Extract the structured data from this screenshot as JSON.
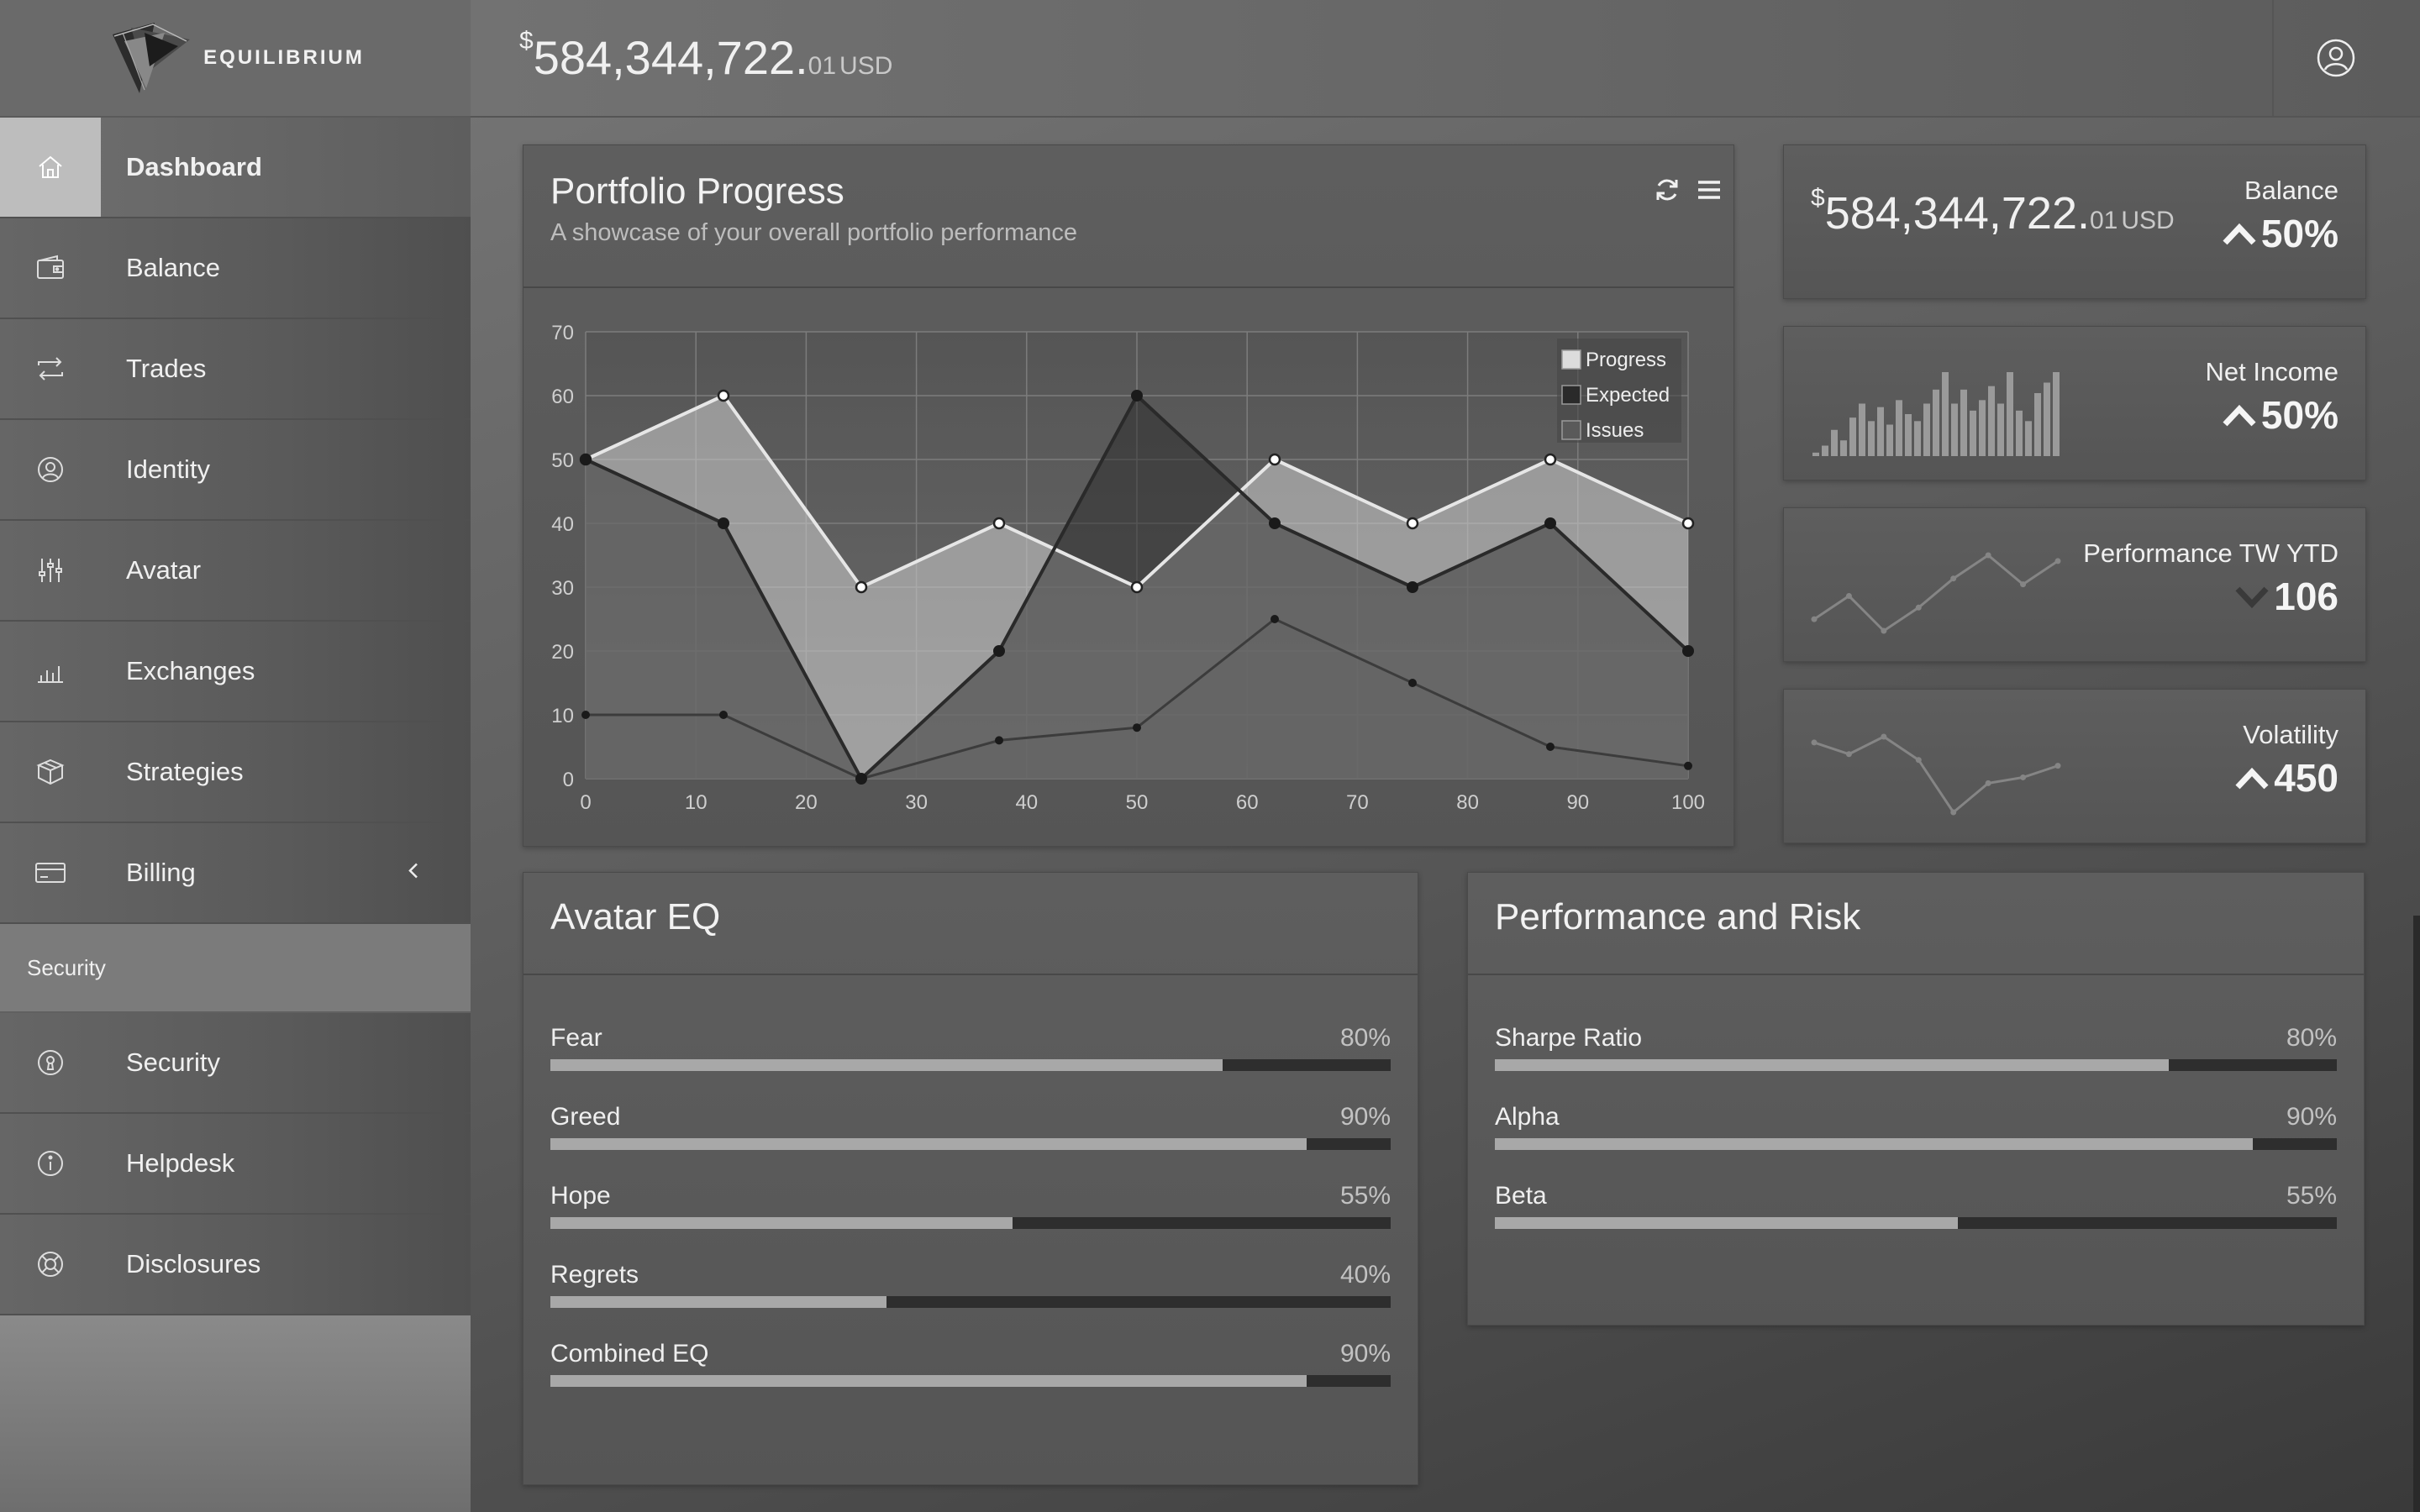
{
  "brand": {
    "name": "EQUILIBRIUM"
  },
  "header": {
    "balance": {
      "currency_symbol": "$",
      "integer": "584,344,722.",
      "cents": "01",
      "unit": "USD"
    },
    "user_icon": "user-icon"
  },
  "sidebar": {
    "items": [
      {
        "label": "Dashboard",
        "icon": "home-icon",
        "active": true
      },
      {
        "label": "Balance",
        "icon": "wallet-icon"
      },
      {
        "label": "Trades",
        "icon": "exchange-arrows-icon"
      },
      {
        "label": "Identity",
        "icon": "user-icon"
      },
      {
        "label": "Avatar",
        "icon": "sliders-icon"
      },
      {
        "label": "Exchanges",
        "icon": "bar-chart-icon"
      },
      {
        "label": "Strategies",
        "icon": "cubes-icon"
      },
      {
        "label": "Billing",
        "icon": "credit-card-icon",
        "chevron": "chevron-left-icon"
      }
    ],
    "section": "Security",
    "section_items": [
      {
        "label": "Security",
        "icon": "keyhole-icon"
      },
      {
        "label": "Helpdesk",
        "icon": "info-icon"
      },
      {
        "label": "Disclosures",
        "icon": "lifebuoy-icon"
      }
    ]
  },
  "portfolio": {
    "title": "Portfolio Progress",
    "subtitle": "A showcase of your overall portfolio performance",
    "refresh_icon": "refresh-icon",
    "menu_icon": "hamburger-menu-icon"
  },
  "chart_data": {
    "type": "area",
    "title": "",
    "xlabel": "",
    "ylabel": "",
    "xlim": [
      0,
      100
    ],
    "ylim": [
      0,
      70
    ],
    "x_ticks": [
      0,
      10,
      20,
      30,
      40,
      50,
      60,
      70,
      80,
      90,
      100
    ],
    "y_ticks": [
      0,
      10,
      20,
      30,
      40,
      50,
      60,
      70
    ],
    "grid": true,
    "legend": "top-right",
    "x": [
      0,
      12.5,
      25,
      37.5,
      50,
      62.5,
      75,
      87.5,
      100
    ],
    "series": [
      {
        "name": "Progress",
        "values": [
          50,
          60,
          30,
          40,
          30,
          50,
          40,
          50,
          40
        ],
        "color": "#d9d9d9"
      },
      {
        "name": "Expected",
        "values": [
          50,
          40,
          0,
          20,
          60,
          40,
          30,
          40,
          20
        ],
        "color": "#2a2a2a"
      },
      {
        "name": "Issues",
        "values": [
          10,
          10,
          0,
          6,
          8,
          25,
          15,
          5,
          2
        ],
        "color": "#4a4a4a"
      }
    ]
  },
  "stats": [
    {
      "label": "Balance",
      "value": "50%",
      "trend": "up",
      "money": {
        "currency_symbol": "$",
        "integer": "584,344,722.",
        "cents": "01",
        "unit": "USD"
      }
    },
    {
      "label": "Net Income",
      "value": "50%",
      "trend": "up",
      "spark_bars": [
        2,
        6,
        15,
        9,
        22,
        30,
        20,
        28,
        18,
        32,
        24,
        20,
        30,
        38,
        48,
        30,
        38,
        26,
        32,
        40,
        30,
        48,
        26,
        20,
        36,
        42,
        48
      ]
    },
    {
      "label": "Performance TW YTD",
      "value": "106",
      "trend": "down",
      "spark_line": [
        10,
        18,
        6,
        14,
        24,
        32,
        22,
        30
      ]
    },
    {
      "label": "Volatility",
      "value": "450",
      "trend": "up",
      "spark_line": [
        30,
        26,
        32,
        24,
        6,
        16,
        18,
        22
      ]
    }
  ],
  "avatar_eq": {
    "title": "Avatar EQ",
    "rows": [
      {
        "label": "Fear",
        "value": 80,
        "text": "80%"
      },
      {
        "label": "Greed",
        "value": 90,
        "text": "90%"
      },
      {
        "label": "Hope",
        "value": 55,
        "text": "55%"
      },
      {
        "label": "Regrets",
        "value": 40,
        "text": "40%"
      },
      {
        "label": "Combined EQ",
        "value": 90,
        "text": "90%"
      }
    ]
  },
  "perf_risk": {
    "title": "Performance and Risk",
    "rows": [
      {
        "label": "Sharpe Ratio",
        "value": 80,
        "text": "80%"
      },
      {
        "label": "Alpha",
        "value": 90,
        "text": "90%"
      },
      {
        "label": "Beta",
        "value": 55,
        "text": "55%"
      }
    ]
  }
}
